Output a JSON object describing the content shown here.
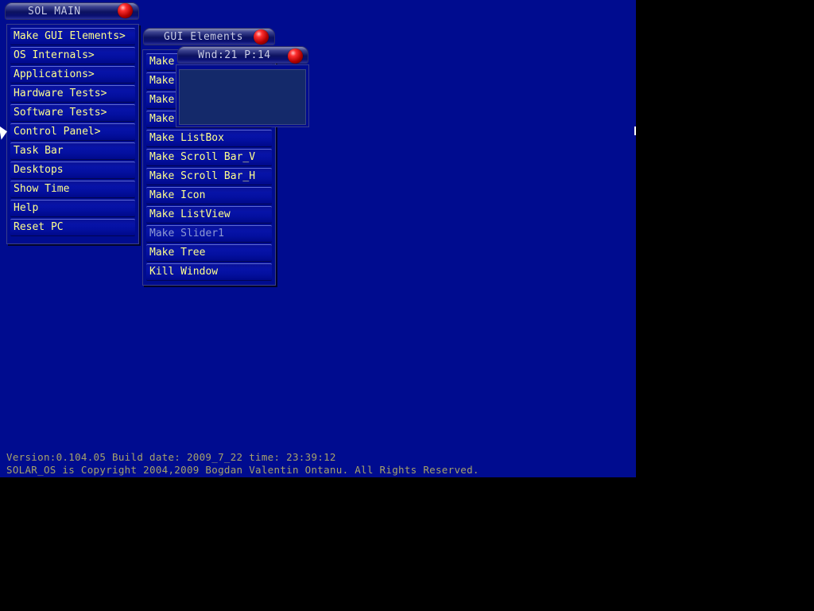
{
  "main_menu": {
    "title": "SOL MAIN",
    "items": [
      {
        "label": "Make GUI Elements>"
      },
      {
        "label": "OS Internals>"
      },
      {
        "label": "Applications>"
      },
      {
        "label": "Hardware Tests>"
      },
      {
        "label": "Software Tests>"
      },
      {
        "label": "Control Panel>"
      },
      {
        "label": "Task Bar"
      },
      {
        "label": "Desktops"
      },
      {
        "label": "Show Time"
      },
      {
        "label": "Help"
      },
      {
        "label": "Reset PC"
      }
    ]
  },
  "gui_menu": {
    "title": "GUI Elements",
    "items": [
      {
        "label": "Make"
      },
      {
        "label": "Make"
      },
      {
        "label": "Make"
      },
      {
        "label": "Make"
      },
      {
        "label": "Make ListBox"
      },
      {
        "label": "Make Scroll Bar_V"
      },
      {
        "label": "Make Scroll Bar_H"
      },
      {
        "label": "Make Icon"
      },
      {
        "label": "Make ListView"
      },
      {
        "label": "Make Slider1",
        "disabled": true
      },
      {
        "label": "Make Tree"
      },
      {
        "label": "Kill Window"
      }
    ]
  },
  "popup_window": {
    "title": "Wnd:21 P:14"
  },
  "status": {
    "version_line": "Version:0.104.05  Build date: 2009_7_22  time: 23:39:12",
    "copyright_line": "SOLAR_OS is Copyright 2004,2009 Bogdan Valentin Ontanu. All Rights Reserved."
  }
}
